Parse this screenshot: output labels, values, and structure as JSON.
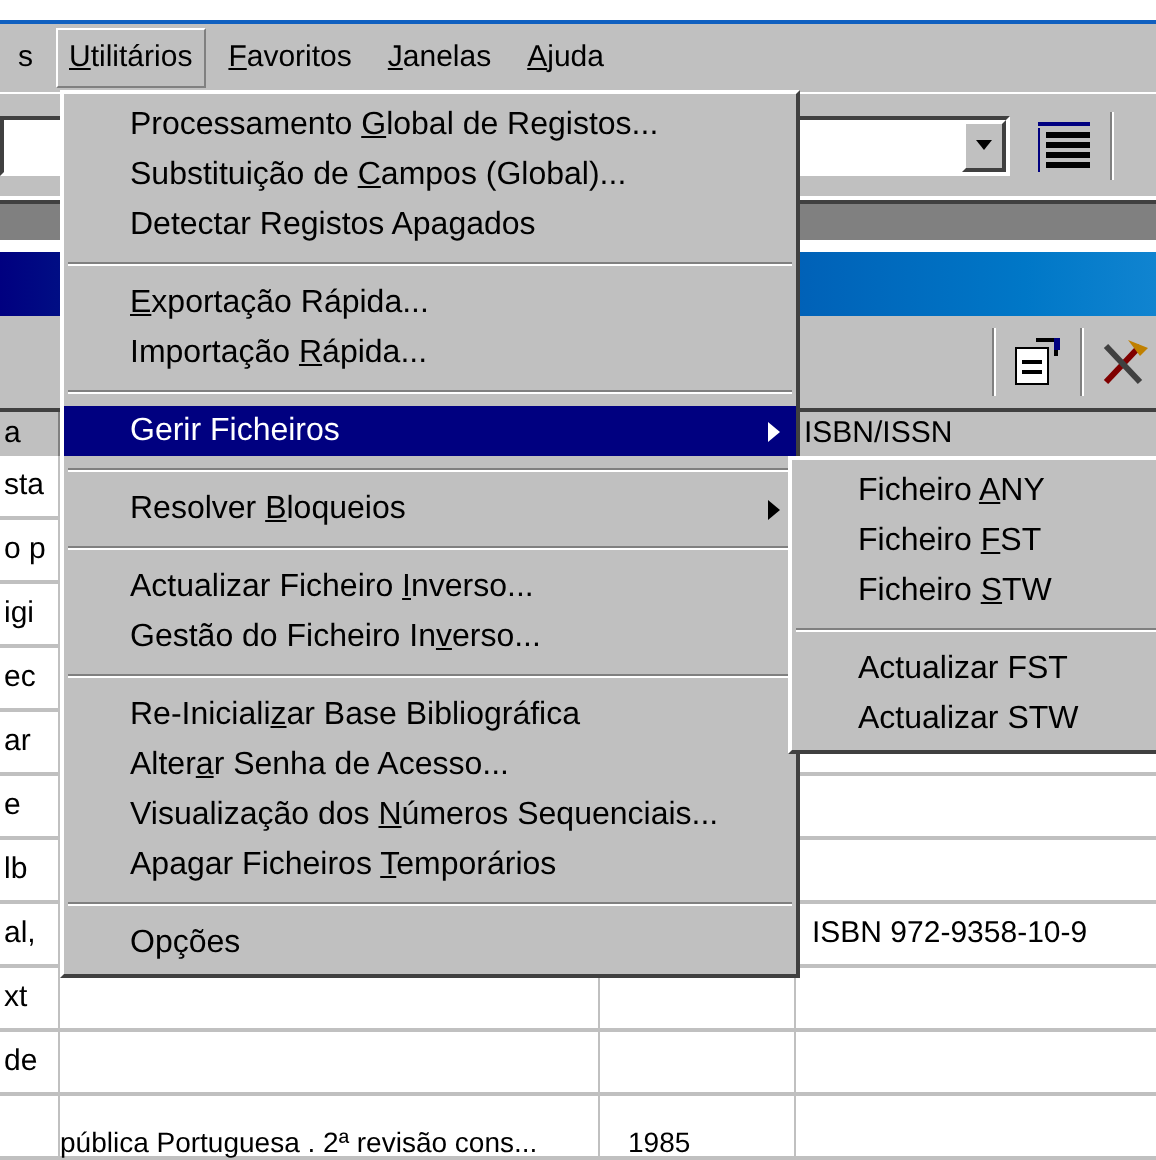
{
  "menubar": [
    {
      "label": [
        {
          "text": "s"
        }
      ],
      "selected": false
    },
    {
      "label": [
        {
          "text": "U",
          "u": true
        },
        {
          "text": "tilitários"
        }
      ],
      "selected": true
    },
    {
      "label": [
        {
          "text": "F",
          "u": true
        },
        {
          "text": "avoritos"
        }
      ],
      "selected": false
    },
    {
      "label": [
        {
          "text": "J",
          "u": true
        },
        {
          "text": "anelas"
        }
      ],
      "selected": false
    },
    {
      "label": [
        {
          "text": "A",
          "u": true
        },
        {
          "text": "juda"
        }
      ],
      "selected": false
    }
  ],
  "table": {
    "header": [
      "a",
      "ISBN/ISSN"
    ],
    "rows": [
      {
        "column_1": "sta"
      },
      {
        "column_1": "o p"
      },
      {
        "column_1": "igi"
      },
      {
        "column_1": "ec"
      },
      {
        "column_1": "ar"
      },
      {
        "column_1": "e"
      },
      {
        "column_1": "lb"
      },
      {
        "column_1": "al,",
        "isbn": "ISBN 972-9358-10-9"
      },
      {
        "column_1": "xt"
      },
      {
        "column_1": "de"
      },
      {
        "column_2": "pública Portuguesa . 2ª revisão cons...",
        "column_3": "1985"
      }
    ]
  },
  "menu": [
    {
      "kind": "item",
      "selected": false,
      "label": [
        {
          "text": "Processamento "
        },
        {
          "text": "G",
          "u": true
        },
        {
          "text": "lobal de Registos..."
        }
      ]
    },
    {
      "kind": "item",
      "selected": false,
      "label": [
        {
          "text": "Substituição de "
        },
        {
          "text": "C",
          "u": true
        },
        {
          "text": "ampos (Global)..."
        }
      ]
    },
    {
      "kind": "item",
      "selected": false,
      "label": [
        {
          "text": "Detectar Registos Apagados"
        }
      ]
    },
    {
      "kind": "separator"
    },
    {
      "kind": "item",
      "selected": false,
      "label": [
        {
          "text": "E",
          "u": true
        },
        {
          "text": "xportação Rápida..."
        }
      ]
    },
    {
      "kind": "item",
      "selected": false,
      "label": [
        {
          "text": "Importação "
        },
        {
          "text": "R",
          "u": true
        },
        {
          "text": "ápida..."
        }
      ]
    },
    {
      "kind": "separator"
    },
    {
      "kind": "submenu",
      "selected": true,
      "label": [
        {
          "text": "Gerir Ficheiros"
        }
      ]
    },
    {
      "kind": "separator"
    },
    {
      "kind": "submenu",
      "selected": false,
      "label": [
        {
          "text": "Resolver "
        },
        {
          "text": "B",
          "u": true
        },
        {
          "text": "loqueios"
        }
      ]
    },
    {
      "kind": "separator"
    },
    {
      "kind": "item",
      "selected": false,
      "label": [
        {
          "text": "Actualizar Ficheiro "
        },
        {
          "text": "I",
          "u": true
        },
        {
          "text": "nverso..."
        }
      ]
    },
    {
      "kind": "item",
      "selected": false,
      "label": [
        {
          "text": "Gestão do Ficheiro In"
        },
        {
          "text": "v",
          "u": true
        },
        {
          "text": "erso..."
        }
      ]
    },
    {
      "kind": "separator"
    },
    {
      "kind": "item",
      "selected": false,
      "label": [
        {
          "text": "Re-Iniciali"
        },
        {
          "text": "z",
          "u": true
        },
        {
          "text": "ar Base Bibliográfica"
        }
      ]
    },
    {
      "kind": "item",
      "selected": false,
      "label": [
        {
          "text": "Alter"
        },
        {
          "text": "a",
          "u": true
        },
        {
          "text": "r Senha de Acesso..."
        }
      ]
    },
    {
      "kind": "item",
      "selected": false,
      "label": [
        {
          "text": "Visualização dos "
        },
        {
          "text": "N",
          "u": true
        },
        {
          "text": "úmeros Sequenciais..."
        }
      ]
    },
    {
      "kind": "item",
      "selected": false,
      "label": [
        {
          "text": "Apagar Ficheiros "
        },
        {
          "text": "T",
          "u": true
        },
        {
          "text": "emporários"
        }
      ]
    },
    {
      "kind": "separator"
    },
    {
      "kind": "item",
      "selected": false,
      "label": [
        {
          "text": "Opções"
        }
      ]
    }
  ],
  "submenu": [
    {
      "kind": "item",
      "label": [
        {
          "text": "Ficheiro "
        },
        {
          "text": "A",
          "u": true
        },
        {
          "text": "NY"
        }
      ]
    },
    {
      "kind": "item",
      "label": [
        {
          "text": "Ficheiro "
        },
        {
          "text": "F",
          "u": true
        },
        {
          "text": "ST"
        }
      ]
    },
    {
      "kind": "item",
      "label": [
        {
          "text": "Ficheiro "
        },
        {
          "text": "S",
          "u": true
        },
        {
          "text": "TW"
        }
      ]
    },
    {
      "kind": "separator"
    },
    {
      "kind": "item",
      "label": [
        {
          "text": "Actualizar FST"
        }
      ]
    },
    {
      "kind": "item",
      "label": [
        {
          "text": "Actualizar STW"
        }
      ]
    }
  ]
}
